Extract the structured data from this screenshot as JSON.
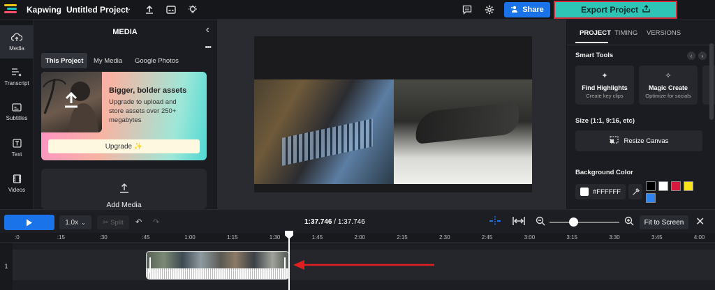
{
  "header": {
    "brand": "Kapwing",
    "breadcrumb_sep": "›",
    "project_title": "Untitled Project",
    "share_label": "Share",
    "export_label": "Export Project",
    "icons": [
      "upload-icon",
      "subtitles-icon",
      "lightbulb-icon",
      "comment-icon",
      "gear-icon"
    ]
  },
  "leftnav": {
    "items": [
      {
        "label": "Media",
        "icon": "☁"
      },
      {
        "label": "Transcript",
        "icon": "☰"
      },
      {
        "label": "Subtitles",
        "icon": "▭"
      },
      {
        "label": "Text",
        "icon": "T"
      },
      {
        "label": "Videos",
        "icon": "▦"
      }
    ]
  },
  "media": {
    "title": "MEDIA",
    "tabs": [
      "This Project",
      "My Media",
      "Google Photos"
    ],
    "promo": {
      "heading": "Bigger, bolder assets",
      "body": "Upgrade to upload and store assets over 250+ megabytes",
      "button": "Upgrade ✨"
    },
    "add_media": "Add Media"
  },
  "right": {
    "tabs": [
      "PROJECT",
      "TIMING",
      "VERSIONS"
    ],
    "smart_tools_heading": "Smart Tools",
    "tools": [
      {
        "title": "Find Highlights",
        "sub": "Create key clips",
        "icon": "✦"
      },
      {
        "title": "Magic Create",
        "sub": "Optimize for socials",
        "icon": "✧"
      }
    ],
    "size_heading": "Size (1:1, 9:16, etc)",
    "resize_label": "Resize Canvas",
    "bg_heading": "Background Color",
    "bg_value": "#FFFFFF",
    "swatches": [
      "#000000",
      "#FFFFFF",
      "#D7193D",
      "#F7E21B",
      "#2F84F0"
    ]
  },
  "timeline": {
    "speed": "1.0x",
    "split": "Split",
    "current_time": "1:37.746",
    "total_time": "1:37.746",
    "fit_label": "Fit to Screen",
    "track_number": "1",
    "ticks": [
      ":0",
      ":15",
      ":30",
      ":45",
      "1:00",
      "1:15",
      "1:30",
      "1:45",
      "2:00",
      "2:15",
      "2:30",
      "2:45",
      "3:00",
      "3:15",
      "3:30",
      "3:45",
      "4:00"
    ]
  },
  "colors": {
    "accent_blue": "#1a73e8",
    "export_teal": "#2ec4b6",
    "highlight_red": "#d42a3a",
    "arrow_red": "#e02020"
  }
}
